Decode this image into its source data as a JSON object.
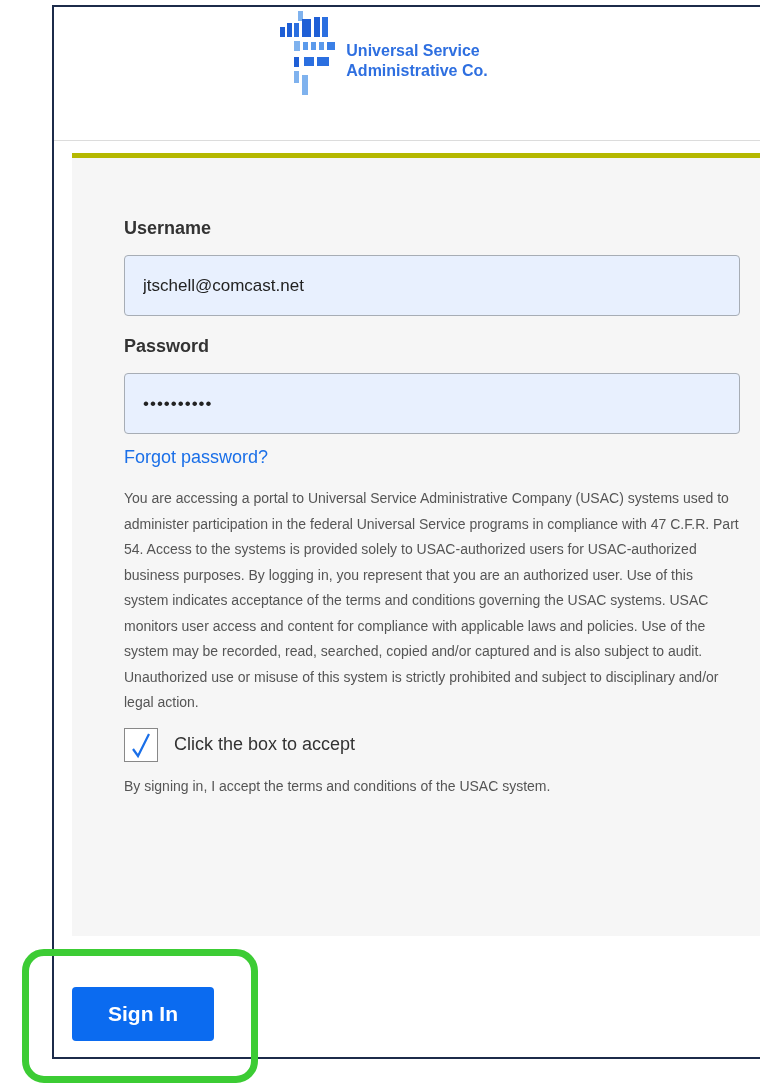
{
  "logo": {
    "line_1": "Universal Service",
    "line_2": "Administrative Co."
  },
  "form": {
    "username": {
      "label": "Username",
      "value": "jtschell@comcast.net"
    },
    "password": {
      "label": "Password",
      "value": "••••••••••"
    },
    "forgot_link": "Forgot password?",
    "notice": "You are accessing a portal to Universal Service Administrative Company (USAC) systems used to administer participation in the federal Universal Service programs in compliance with 47 C.F.R. Part 54. Access to the systems is provided solely to USAC-authorized users for USAC-authorized business purposes. By logging in, you represent that you are an authorized user. Use of this system indicates acceptance of the terms and conditions governing the USAC systems. USAC monitors user access and content for compliance with applicable laws and policies. Use of the system may be recorded, read, searched, copied and/or captured and is also subject to audit. Unauthorized use or misuse of this system is strictly prohibited and subject to disciplinary and/or legal action.",
    "accept": {
      "label": "Click the box to accept",
      "checked": true
    },
    "terms_note": "By signing in, I accept the terms and conditions of the USAC system."
  },
  "sign_in_button": "Sign In"
}
